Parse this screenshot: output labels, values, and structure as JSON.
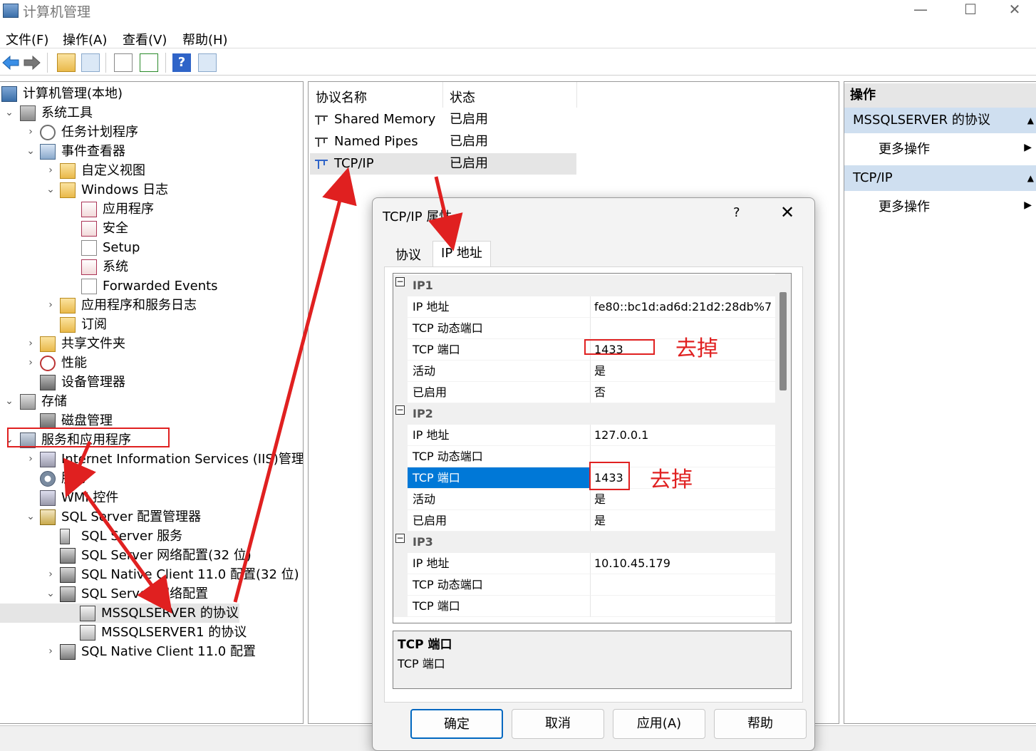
{
  "window": {
    "title": "计算机管理",
    "controls": {
      "minimize": "—",
      "maximize": "☐",
      "close": "✕"
    }
  },
  "menubar": [
    "文件(F)",
    "操作(A)",
    "查看(V)",
    "帮助(H)"
  ],
  "toolbar": [
    "back-icon",
    "forward-icon",
    "up-folder-icon",
    "show-tree-icon",
    "properties-icon",
    "export-icon",
    "help-icon",
    "action-pane-icon"
  ],
  "tree": [
    {
      "label": "计算机管理(本地)",
      "toggle": "",
      "icon": "computer"
    },
    {
      "label": "系统工具",
      "toggle": "⌄",
      "icon": "tools"
    },
    {
      "label": "任务计划程序",
      "toggle": "›",
      "icon": "clock"
    },
    {
      "label": "事件查看器",
      "toggle": "⌄",
      "icon": "event"
    },
    {
      "label": "自定义视图",
      "toggle": "›",
      "icon": "folder"
    },
    {
      "label": "Windows 日志",
      "toggle": "⌄",
      "icon": "folder"
    },
    {
      "label": "应用程序",
      "toggle": "",
      "icon": "log"
    },
    {
      "label": "安全",
      "toggle": "",
      "icon": "log"
    },
    {
      "label": "Setup",
      "toggle": "",
      "icon": "doc"
    },
    {
      "label": "系统",
      "toggle": "",
      "icon": "log"
    },
    {
      "label": "Forwarded Events",
      "toggle": "",
      "icon": "doc"
    },
    {
      "label": "应用程序和服务日志",
      "toggle": "›",
      "icon": "folder"
    },
    {
      "label": "订阅",
      "toggle": "",
      "icon": "folder"
    },
    {
      "label": "共享文件夹",
      "toggle": "›",
      "icon": "folder"
    },
    {
      "label": "性能",
      "toggle": "›",
      "icon": "perf"
    },
    {
      "label": "设备管理器",
      "toggle": "",
      "icon": "device"
    },
    {
      "label": "存储",
      "toggle": "⌄",
      "icon": "storage"
    },
    {
      "label": "磁盘管理",
      "toggle": "",
      "icon": "device"
    },
    {
      "label": "服务和应用程序",
      "toggle": "⌄",
      "icon": "services"
    },
    {
      "label": "Internet Information Services (IIS)管理器",
      "toggle": "›",
      "icon": "wmi"
    },
    {
      "label": "服务",
      "toggle": "",
      "icon": "gear"
    },
    {
      "label": "WMI 控件",
      "toggle": "",
      "icon": "wmi"
    },
    {
      "label": "SQL Server 配置管理器",
      "toggle": "⌄",
      "icon": "sql"
    },
    {
      "label": "SQL Server 服务",
      "toggle": "",
      "icon": "server"
    },
    {
      "label": "SQL Server 网络配置(32 位)",
      "toggle": "",
      "icon": "net"
    },
    {
      "label": "SQL Native Client 11.0 配置(32 位)",
      "toggle": "›",
      "icon": "net"
    },
    {
      "label": "SQL Server 网络配置",
      "toggle": "⌄",
      "icon": "net"
    },
    {
      "label": "MSSQLSERVER 的协议",
      "toggle": "",
      "icon": "proto"
    },
    {
      "label": "MSSQLSERVER1 的协议",
      "toggle": "",
      "icon": "proto"
    },
    {
      "label": "SQL Native Client 11.0 配置",
      "toggle": "›",
      "icon": "net"
    }
  ],
  "list": {
    "headers": {
      "name": "协议名称",
      "status": "状态"
    },
    "rows": [
      {
        "name": "Shared Memory",
        "status": "已启用"
      },
      {
        "name": "Named Pipes",
        "status": "已启用"
      },
      {
        "name": "TCP/IP",
        "status": "已启用"
      }
    ]
  },
  "actions": {
    "header": "操作",
    "sections": [
      {
        "title": "MSSQLSERVER 的协议",
        "item": "更多操作"
      },
      {
        "title": "TCP/IP",
        "item": "更多操作"
      }
    ]
  },
  "dialog": {
    "title": "TCP/IP 属性",
    "help": "?",
    "close": "✕",
    "tabs": [
      "协议",
      "IP 地址"
    ],
    "grid": [
      {
        "type": "cat",
        "label": "IP1",
        "toggle": "−"
      },
      {
        "type": "row",
        "key": "IP 地址",
        "value": "fe80::bc1d:ad6d:21d2:28db%7"
      },
      {
        "type": "row",
        "key": "TCP 动态端口",
        "value": ""
      },
      {
        "type": "row",
        "key": "TCP 端口",
        "value": "1433"
      },
      {
        "type": "row",
        "key": "活动",
        "value": "是"
      },
      {
        "type": "row",
        "key": "已启用",
        "value": "否"
      },
      {
        "type": "cat",
        "label": "IP2",
        "toggle": "−"
      },
      {
        "type": "row",
        "key": "IP 地址",
        "value": "127.0.0.1"
      },
      {
        "type": "row",
        "key": "TCP 动态端口",
        "value": ""
      },
      {
        "type": "row",
        "key": "TCP 端口",
        "value": "1433",
        "selected": true
      },
      {
        "type": "row",
        "key": "活动",
        "value": "是"
      },
      {
        "type": "row",
        "key": "已启用",
        "value": "是"
      },
      {
        "type": "cat",
        "label": "IP3",
        "toggle": "−"
      },
      {
        "type": "row",
        "key": "IP 地址",
        "value": "10.10.45.179"
      },
      {
        "type": "row",
        "key": "TCP 动态端口",
        "value": ""
      },
      {
        "type": "row",
        "key": "TCP 端口",
        "value": ""
      }
    ],
    "description": {
      "title": "TCP 端口",
      "text": "TCP 端口"
    },
    "buttons": [
      "确定",
      "取消",
      "应用(A)",
      "帮助"
    ]
  },
  "annotations": {
    "note1": "去掉",
    "note2": "去掉",
    "color": "#e02020"
  }
}
